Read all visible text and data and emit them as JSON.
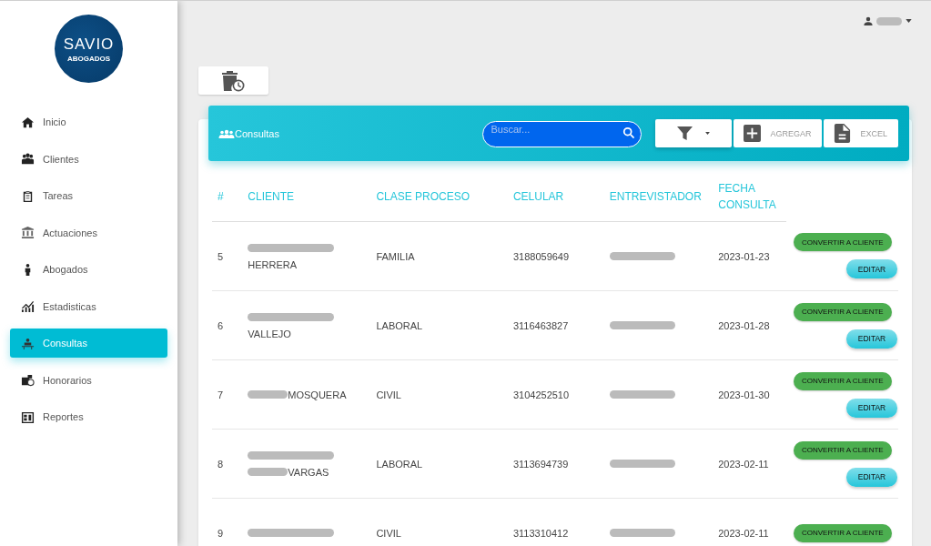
{
  "logo": {
    "name": "SAVIO",
    "sub": "ABOGADOS"
  },
  "sidebar": {
    "items": [
      {
        "label": "Inicio",
        "selected": false
      },
      {
        "label": "Clientes",
        "selected": false
      },
      {
        "label": "Tareas",
        "selected": false
      },
      {
        "label": "Actuaciones",
        "selected": false
      },
      {
        "label": "Abogados",
        "selected": false
      },
      {
        "label": "Estadisticas",
        "selected": false
      },
      {
        "label": "Consultas",
        "selected": true
      },
      {
        "label": "Honorarios",
        "selected": false
      },
      {
        "label": "Reportes",
        "selected": false
      }
    ]
  },
  "user_menu": {
    "name": [
      {
        "kind": "blur"
      }
    ]
  },
  "panel": {
    "title": "Consultas",
    "search": {
      "placeholder": "Buscar..."
    },
    "buttons": [
      {
        "kind": "filter"
      },
      {
        "kind": "add",
        "label": "AGREGAR"
      },
      {
        "kind": "file",
        "label": "EXCEL"
      }
    ]
  },
  "table": {
    "columns": [
      "#",
      "CLIENTE",
      "CLASE PROCESO",
      "CELULAR",
      "ENTREVISTADOR",
      "FECHA CONSULTA"
    ],
    "rows": [
      {
        "n": "5",
        "client": [
          [
            {
              "kind": "blur"
            }
          ],
          [
            {
              "kind": "text",
              "text": "HERRERA"
            }
          ]
        ],
        "clase": "FAMILIA",
        "celular": "3188059649",
        "interviewer": [
          {
            "kind": "blur"
          }
        ],
        "fecha": "2023-01-23",
        "actions": [
          "CONVERTIR A CLIENTE",
          "EDITAR"
        ]
      },
      {
        "n": "6",
        "client": [
          [
            {
              "kind": "blur"
            }
          ],
          [
            {
              "kind": "text",
              "text": "VALLEJO"
            }
          ]
        ],
        "clase": "LABORAL",
        "celular": "3116463827",
        "interviewer": [
          {
            "kind": "blur"
          }
        ],
        "fecha": "2023-01-28",
        "actions": [
          "CONVERTIR A CLIENTE",
          "EDITAR"
        ]
      },
      {
        "n": "7",
        "client": [
          [
            {
              "kind": "blur"
            },
            {
              "kind": "text",
              "text": "MOSQUERA"
            }
          ]
        ],
        "clase": "CIVIL",
        "celular": "3104252510",
        "interviewer": [
          {
            "kind": "blur"
          }
        ],
        "fecha": "2023-01-30",
        "actions": [
          "CONVERTIR A CLIENTE",
          "EDITAR"
        ]
      },
      {
        "n": "8",
        "client": [
          [
            {
              "kind": "blur"
            }
          ],
          [
            {
              "kind": "blur"
            },
            {
              "kind": "text",
              "text": "VARGAS"
            }
          ]
        ],
        "clase": "LABORAL",
        "celular": "3113694739",
        "interviewer": [
          {
            "kind": "blur"
          }
        ],
        "fecha": "2023-02-11",
        "actions": [
          "CONVERTIR A CLIENTE",
          "EDITAR"
        ]
      },
      {
        "n": "9",
        "client": [
          [
            {
              "kind": "blur"
            }
          ]
        ],
        "clase": "CIVIL",
        "celular": "3113310412",
        "interviewer": [
          {
            "kind": "blur"
          }
        ],
        "fecha": "2023-02-11",
        "actions": [
          "CONVERTIR A CLIENTE"
        ]
      }
    ]
  }
}
